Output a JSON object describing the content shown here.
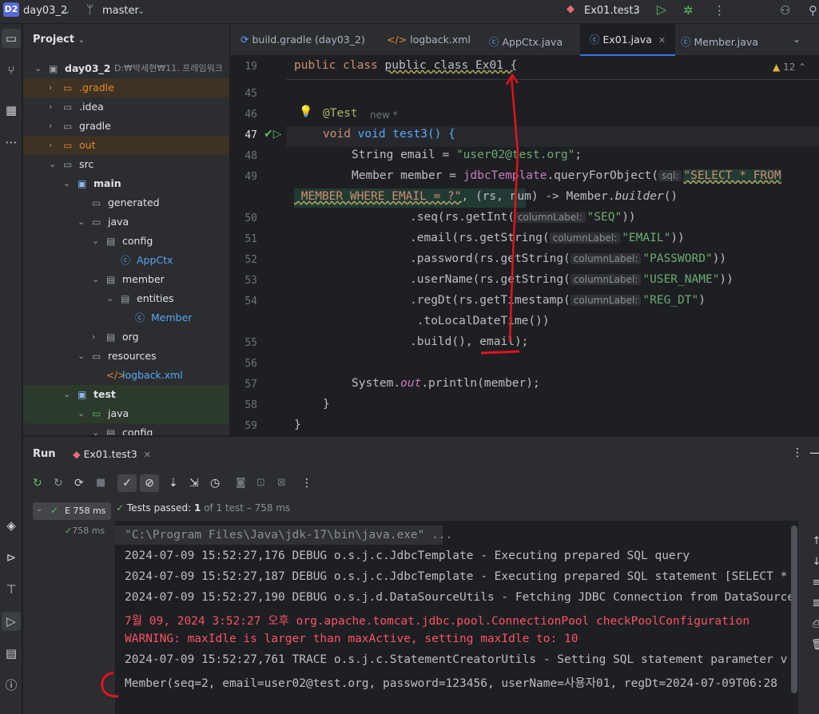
{
  "titlebar": {
    "project_badge": "D2",
    "project_name": "day03_2",
    "branch": "master",
    "run_config": "Ex01.test3"
  },
  "project_panel": {
    "title": "Project",
    "tree": [
      {
        "label": "day03_2",
        "extra": "D:₩박세현₩11. 프레임워크",
        "level": 0,
        "kind": "module",
        "open": true
      },
      {
        "label": ".gradle",
        "level": 1,
        "kind": "folder",
        "open": false,
        "excluded": true
      },
      {
        "label": ".idea",
        "level": 1,
        "kind": "folder",
        "open": false
      },
      {
        "label": "gradle",
        "level": 1,
        "kind": "folder",
        "open": false
      },
      {
        "label": "out",
        "level": 1,
        "kind": "folder",
        "open": false,
        "excluded": true
      },
      {
        "label": "src",
        "level": 1,
        "kind": "folder",
        "open": true
      },
      {
        "label": "main",
        "level": 2,
        "kind": "srcroot",
        "open": true
      },
      {
        "label": "generated",
        "level": 3,
        "kind": "folder"
      },
      {
        "label": "java",
        "level": 3,
        "kind": "folder",
        "open": true
      },
      {
        "label": "config",
        "level": 4,
        "kind": "package",
        "open": true
      },
      {
        "label": "AppCtx",
        "level": 5,
        "kind": "class"
      },
      {
        "label": "member",
        "level": 4,
        "kind": "package",
        "open": true
      },
      {
        "label": "entities",
        "level": 5,
        "kind": "package",
        "open": true
      },
      {
        "label": "Member",
        "level": 6,
        "kind": "class"
      },
      {
        "label": "org",
        "level": 4,
        "kind": "package",
        "open": false
      },
      {
        "label": "resources",
        "level": 3,
        "kind": "folder",
        "open": true
      },
      {
        "label": "logback.xml",
        "level": 4,
        "kind": "xml"
      },
      {
        "label": "test",
        "level": 2,
        "kind": "srcroot",
        "open": true
      },
      {
        "label": "java",
        "level": 3,
        "kind": "testfolder",
        "open": true
      },
      {
        "label": "config",
        "level": 4,
        "kind": "package",
        "open": true
      }
    ]
  },
  "editor_tabs": [
    {
      "label": "build.gradle (day03_2)",
      "icon": "gradle-icon"
    },
    {
      "label": "logback.xml",
      "icon": "xml-icon"
    },
    {
      "label": "AppCtx.java",
      "icon": "class-icon"
    },
    {
      "label": "Ex01.java",
      "icon": "class-icon",
      "active": true
    },
    {
      "label": "Member.java",
      "icon": "class-icon"
    }
  ],
  "editor": {
    "warnings": "12",
    "line_numbers": [
      "19",
      "45",
      "46",
      "47",
      "48",
      "49",
      "",
      "50",
      "51",
      "52",
      "53",
      "54",
      "",
      "55",
      "56",
      "57",
      "58",
      "59"
    ],
    "sticky_line": "public class Ex01 {",
    "annotation": "@Test",
    "annotation_hint": "new *",
    "lines": {
      "l47": "void test3() {",
      "l48_a": "String email = ",
      "l48_b": "\"user02@test.org\"",
      "l49_a": "Member member = ",
      "l49_b": "jdbcTemplate",
      "l49_c": ".queryForObject(",
      "l49_hint": "sql:",
      "l49_d": "\"SELECT * FROM",
      "l49w_a": " MEMBER WHERE EMAIL = ?\"",
      "l49w_b": ", (rs, num) -> Member.",
      "l49w_c": "builder",
      "l49w_d": "()",
      "l50_a": ".seq(rs.getInt(",
      "l50_b": "\"SEQ\"",
      "l50_c": "))",
      "l51_a": ".email(rs.getString(",
      "l51_b": "\"EMAIL\"",
      "l51_c": "))",
      "l52_a": ".password(rs.getString(",
      "l52_b": "\"PASSWORD\"",
      "l52_c": "))",
      "l53_a": ".userName(rs.getString(",
      "l53_b": "\"USER_NAME\"",
      "l53_c": "))",
      "l54_a": ".regDt(rs.getTimestamp(",
      "l54_b": "\"REG_DT\"",
      "l54_c": ")",
      "l54w": " .toLocalDateTime())",
      "l55": ".build(), email);",
      "l57_a": "System.",
      "l57_b": "out",
      "l57_c": ".println(member);",
      "l58": "}",
      "l59": "}"
    },
    "hint_label": "columnLabel:"
  },
  "run_panel": {
    "title": "Run",
    "tab": "Ex01.test3",
    "tree_item": "E 758 ms",
    "tree_sub": "758 ms",
    "status_prefix": "Tests passed:",
    "status_count": "1",
    "status_suffix": "of 1 test – 758 ms",
    "console": [
      {
        "text": "\"C:\\Program Files\\Java\\jdk-17\\bin\\java.exe\" ...",
        "color": "gray"
      },
      {
        "text": "2024-07-09 15:52:27,176 DEBUG o.s.j.c.JdbcTemplate - Executing prepared SQL query",
        "color": "normal"
      },
      {
        "text": "2024-07-09 15:52:27,187 DEBUG o.s.j.c.JdbcTemplate - Executing prepared SQL statement [SELECT *",
        "color": "normal"
      },
      {
        "text": "2024-07-09 15:52:27,190 DEBUG o.s.j.d.DataSourceUtils - Fetching JDBC Connection from DataSource",
        "color": "normal"
      },
      {
        "text": "7월 09, 2024 3:52:27 오후 org.apache.tomcat.jdbc.pool.ConnectionPool checkPoolConfiguration",
        "color": "red"
      },
      {
        "text": "WARNING: maxIdle is larger than maxActive, setting maxIdle to: 10",
        "color": "red"
      },
      {
        "text": "2024-07-09 15:52:27,761 TRACE o.s.j.c.StatementCreatorUtils - Setting SQL statement parameter v",
        "color": "normal"
      },
      {
        "text": "Member(seq=2, email=user02@test.org, password=123456, userName=사용자01, regDt=2024-07-09T06:28",
        "color": "normal"
      }
    ]
  },
  "colors": {
    "accent": "#3574f0",
    "success": "#5fb865",
    "error": "#f75464",
    "annotation_red": "#e0141e"
  }
}
